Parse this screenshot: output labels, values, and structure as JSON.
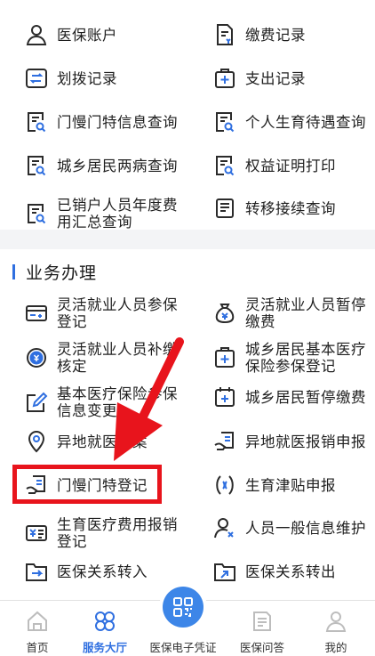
{
  "top_items": [
    {
      "label": "医保账户",
      "icon": "user-icon"
    },
    {
      "label": "缴费记录",
      "icon": "payment-record-icon"
    },
    {
      "label": "划拨记录",
      "icon": "transfer-icon"
    },
    {
      "label": "支出记录",
      "icon": "expense-icon"
    },
    {
      "label": "门慢门特信息查询",
      "icon": "doc-search-icon"
    },
    {
      "label": "个人生育待遇查询",
      "icon": "doc-search-icon"
    },
    {
      "label": "城乡居民两病查询",
      "icon": "doc-search-icon"
    },
    {
      "label": "权益证明打印",
      "icon": "doc-search-icon"
    },
    {
      "label": "已销户人员年度费用汇总查询",
      "line1": "已销户人员年度费",
      "line2": "用汇总查询",
      "icon": "doc-search-icon"
    },
    {
      "label": "转移接续查询",
      "icon": "list-doc-icon"
    }
  ],
  "section": {
    "title": "业务办理"
  },
  "biz_items": [
    {
      "label": "灵活就业人员参保登记",
      "line1": "灵活就业人员参保",
      "line2": "登记",
      "icon": "id-card-icon"
    },
    {
      "label": "灵活就业人员暂停缴费",
      "line1": "灵活就业人员暂停",
      "line2": "缴费",
      "icon": "money-bag-icon"
    },
    {
      "label": "灵活就业人员补缴核定",
      "line1": "灵活就业人员补缴",
      "line2": "核定",
      "icon": "coin-icon"
    },
    {
      "label": "城乡居民基本医疗保险参保登记",
      "line1": "城乡居民基本医疗",
      "line2": "保险参保登记",
      "icon": "medical-plus-icon"
    },
    {
      "label": "基本医疗保险参保信息变更",
      "line1": "基本医疗保险参保",
      "line2": "信息变更",
      "icon": "edit-icon"
    },
    {
      "label": "城乡居民暂停缴费",
      "icon": "calendar-plus-icon"
    },
    {
      "label": "异地就医备案",
      "icon": "location-icon"
    },
    {
      "label": "异地就医报销申报",
      "icon": "reimburse-icon"
    },
    {
      "label": "门慢门特登记",
      "icon": "hand-doc-icon"
    },
    {
      "label": "生育津贴申报",
      "icon": "maternity-icon"
    },
    {
      "label": "生育医疗费用报销登记",
      "line1": "生育医疗费用报销",
      "line2": "登记",
      "icon": "yuan-card-icon"
    },
    {
      "label": "人员一般信息维护",
      "icon": "user-x-icon"
    },
    {
      "label": "医保关系转入",
      "icon": "folder-in-icon"
    },
    {
      "label": "医保关系转出",
      "icon": "folder-out-icon"
    }
  ],
  "tabbar": [
    {
      "label": "首页",
      "icon": "home-icon"
    },
    {
      "label": "服务大厅",
      "icon": "service-hall-icon",
      "active": true
    },
    {
      "label": "医保电子凭证",
      "icon": "qr-code-icon"
    },
    {
      "label": "医保问答",
      "icon": "qa-icon"
    },
    {
      "label": "我的",
      "icon": "profile-icon"
    }
  ],
  "colors": {
    "accent": "#2f6fe0",
    "highlight": "#e8141c",
    "icon": "#2b2b2b",
    "background": "#f3f4f6"
  }
}
